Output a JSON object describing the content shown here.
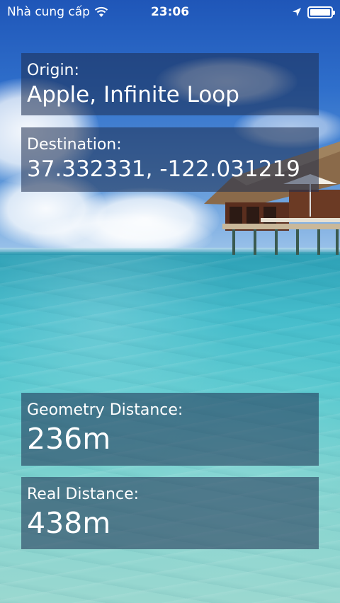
{
  "status_bar": {
    "carrier": "Nhà cung cấp",
    "time": "23:06",
    "battery_level": 1.0
  },
  "origin": {
    "label": "Origin:",
    "value": "Apple, Infinite Loop"
  },
  "destination": {
    "label": "Destination:",
    "value": "37.332331, -122.031219"
  },
  "geometry_distance": {
    "label": "Geometry Distance:",
    "value": "236m"
  },
  "real_distance": {
    "label": "Real Distance:",
    "value": "438m"
  },
  "icons": {
    "wifi": "wifi-icon",
    "location": "location-arrow-icon",
    "battery": "battery-icon"
  },
  "colors": {
    "panel_background": "#1e2d50",
    "text": "#ffffff"
  }
}
